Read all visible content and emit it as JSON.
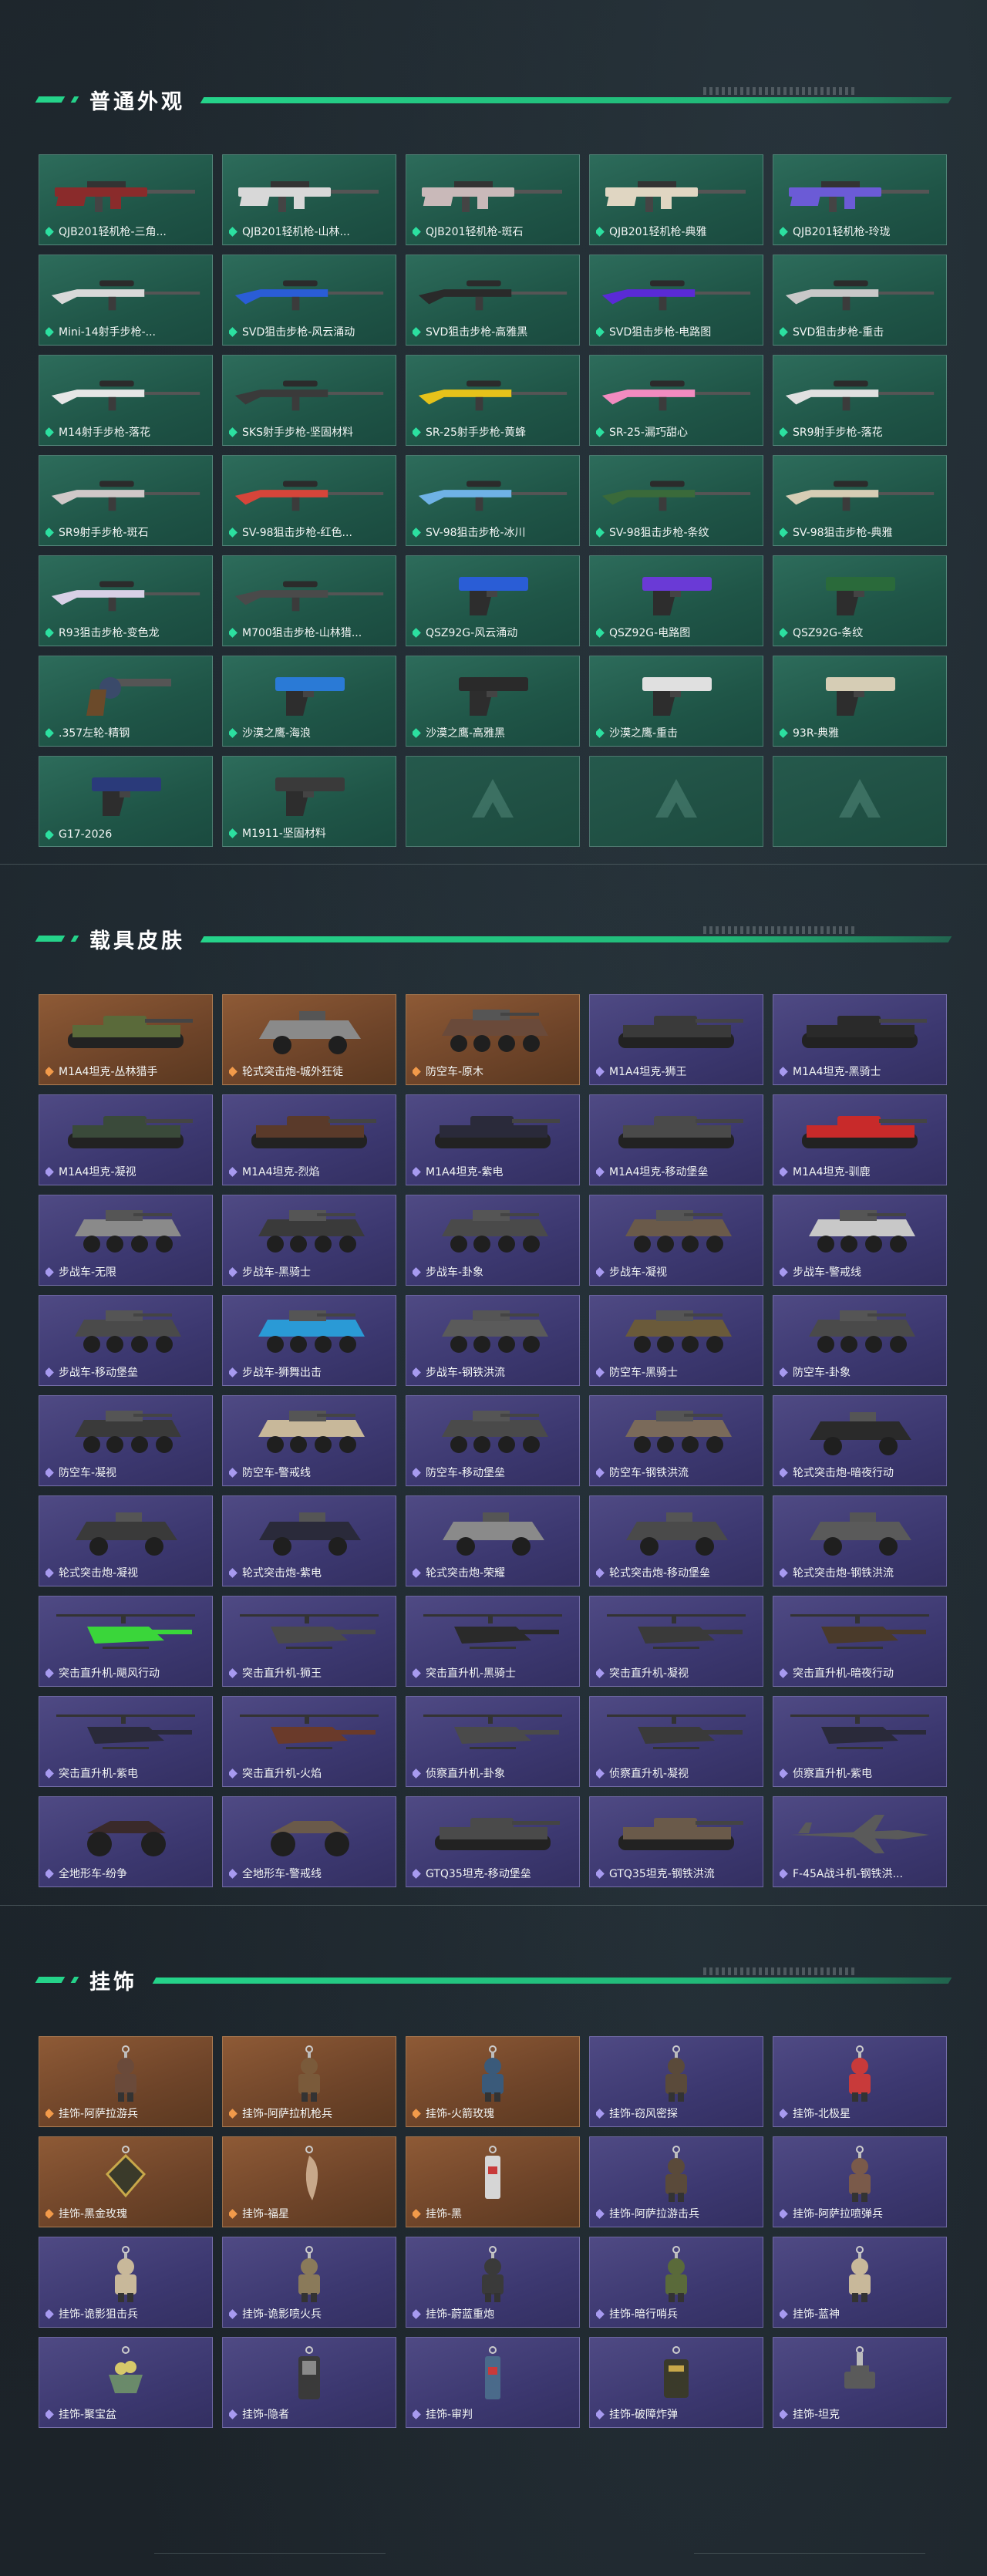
{
  "sections": [
    {
      "title": "普通外观",
      "theme": "green",
      "items": [
        {
          "label": "QJB201轻机枪-三角...",
          "icon": "rifle-icon",
          "accent": "#8a2b2b"
        },
        {
          "label": "QJB201轻机枪-山林...",
          "icon": "rifle-icon",
          "accent": "#d8d8d8"
        },
        {
          "label": "QJB201轻机枪-斑石",
          "icon": "rifle-icon",
          "accent": "#c9b9b9"
        },
        {
          "label": "QJB201轻机枪-典雅",
          "icon": "rifle-icon",
          "accent": "#e0d6c2"
        },
        {
          "label": "QJB201轻机枪-玲珑",
          "icon": "rifle-icon",
          "accent": "#6b5bd6"
        },
        {
          "label": "Mini-14射手步枪-...",
          "icon": "sniper-rifle-icon",
          "accent": "#d9d9d9"
        },
        {
          "label": "SVD狙击步枪-风云涌动",
          "icon": "sniper-rifle-icon",
          "accent": "#2a5dd6"
        },
        {
          "label": "SVD狙击步枪-高雅黑",
          "icon": "sniper-rifle-icon",
          "accent": "#2a2a2a"
        },
        {
          "label": "SVD狙击步枪-电路图",
          "icon": "sniper-rifle-icon",
          "accent": "#5a2ad6"
        },
        {
          "label": "SVD狙击步枪-重击",
          "icon": "sniper-rifle-icon",
          "accent": "#c8c8c8"
        },
        {
          "label": "M14射手步枪-落花",
          "icon": "sniper-rifle-icon",
          "accent": "#e6e6e6"
        },
        {
          "label": "SKS射手步枪-坚固材料",
          "icon": "sniper-rifle-icon",
          "accent": "#3a3a3a"
        },
        {
          "label": "SR-25射手步枪-黄蜂",
          "icon": "sniper-rifle-icon",
          "accent": "#e6c21a"
        },
        {
          "label": "SR-25-漏巧甜心",
          "icon": "sniper-rifle-icon",
          "accent": "#f28bc0"
        },
        {
          "label": "SR9射手步枪-落花",
          "icon": "sniper-rifle-icon",
          "accent": "#e0e0e0"
        },
        {
          "label": "SR9射手步枪-斑石",
          "icon": "sniper-rifle-icon",
          "accent": "#d0c8c8"
        },
        {
          "label": "SV-98狙击步枪-红色...",
          "icon": "sniper-rifle-icon",
          "accent": "#d6453a"
        },
        {
          "label": "SV-98狙击步枪-冰川",
          "icon": "sniper-rifle-icon",
          "accent": "#6fb2e6"
        },
        {
          "label": "SV-98狙击步枪-条纹",
          "icon": "sniper-rifle-icon",
          "accent": "#3a6a3a"
        },
        {
          "label": "SV-98狙击步枪-典雅",
          "icon": "sniper-rifle-icon",
          "accent": "#d6cdb5"
        },
        {
          "label": "R93狙击步枪-变色龙",
          "icon": "sniper-rifle-icon",
          "accent": "#d8d0e6"
        },
        {
          "label": "M700狙击步枪-山林猎...",
          "icon": "sniper-rifle-icon",
          "accent": "#4a4a4a"
        },
        {
          "label": "QSZ92G-风云涌动",
          "icon": "pistol-icon",
          "accent": "#2a5dd6"
        },
        {
          "label": "QSZ92G-电路图",
          "icon": "pistol-icon",
          "accent": "#6a3ad6"
        },
        {
          "label": "QSZ92G-条纹",
          "icon": "pistol-icon",
          "accent": "#2a6a3a"
        },
        {
          "label": ".357左轮-精钢",
          "icon": "revolver-icon",
          "accent": "#3a4a6a"
        },
        {
          "label": "沙漠之鹰-海浪",
          "icon": "pistol-icon",
          "accent": "#2a7ad6"
        },
        {
          "label": "沙漠之鹰-高雅黑",
          "icon": "pistol-icon",
          "accent": "#2a2a2a"
        },
        {
          "label": "沙漠之鹰-重击",
          "icon": "pistol-icon",
          "accent": "#e0e0e0"
        },
        {
          "label": "93R-典雅",
          "icon": "pistol-icon",
          "accent": "#d6cdb5"
        },
        {
          "label": "G17-2026",
          "icon": "pistol-icon",
          "accent": "#2a3a7a"
        },
        {
          "label": "M1911-坚固材料",
          "icon": "pistol-icon",
          "accent": "#3a3a3a"
        },
        {
          "label": "",
          "icon": "placeholder-logo-icon",
          "empty": true
        },
        {
          "label": "",
          "icon": "placeholder-logo-icon",
          "empty": true
        },
        {
          "label": "",
          "icon": "placeholder-logo-icon",
          "empty": true
        }
      ]
    },
    {
      "title": "载具皮肤",
      "items": [
        {
          "label": "M1A4坦克-丛林猎手",
          "icon": "tank-icon",
          "theme": "orange",
          "accent": "#5a6a3a"
        },
        {
          "label": "轮式突击炮-城外狂徒",
          "icon": "armored-car-icon",
          "theme": "orange",
          "accent": "#8a8a8a"
        },
        {
          "label": "防空车-原木",
          "icon": "apc-icon",
          "theme": "orange",
          "accent": "#6a4a3a"
        },
        {
          "label": "M1A4坦克-狮王",
          "icon": "tank-icon",
          "theme": "purple",
          "accent": "#3a3a3a"
        },
        {
          "label": "M1A4坦克-黑骑士",
          "icon": "tank-icon",
          "theme": "purple",
          "accent": "#2a2a2a"
        },
        {
          "label": "M1A4坦克-凝视",
          "icon": "tank-icon",
          "theme": "purple",
          "accent": "#3a4a3a"
        },
        {
          "label": "M1A4坦克-烈焰",
          "icon": "tank-icon",
          "theme": "purple",
          "accent": "#5a3a2a"
        },
        {
          "label": "M1A4坦克-紫电",
          "icon": "tank-icon",
          "theme": "purple",
          "accent": "#2a2a3a"
        },
        {
          "label": "M1A4坦克-移动堡垒",
          "icon": "tank-icon",
          "theme": "purple",
          "accent": "#4a4a4a"
        },
        {
          "label": "M1A4坦克-驯鹿",
          "icon": "tank-icon",
          "theme": "purple",
          "accent": "#c82a2a"
        },
        {
          "label": "步战车-无限",
          "icon": "apc-icon",
          "theme": "purple",
          "accent": "#8a8a8a"
        },
        {
          "label": "步战车-黑骑士",
          "icon": "apc-icon",
          "theme": "purple",
          "accent": "#3a3a3a"
        },
        {
          "label": "步战车-卦象",
          "icon": "apc-icon",
          "theme": "purple",
          "accent": "#4a4a4a"
        },
        {
          "label": "步战车-凝视",
          "icon": "apc-icon",
          "theme": "purple",
          "accent": "#6a5a4a"
        },
        {
          "label": "步战车-警戒线",
          "icon": "apc-icon",
          "theme": "purple",
          "accent": "#c8c8c8"
        },
        {
          "label": "步战车-移动堡垒",
          "icon": "apc-icon",
          "theme": "purple",
          "accent": "#4a4a4a"
        },
        {
          "label": "步战车-狮舞出击",
          "icon": "apc-icon",
          "theme": "purple",
          "accent": "#2a9ad6"
        },
        {
          "label": "步战车-钢铁洪流",
          "icon": "apc-icon",
          "theme": "purple",
          "accent": "#5a5a5a"
        },
        {
          "label": "防空车-黑骑士",
          "icon": "apc-icon",
          "theme": "purple",
          "accent": "#6a5a3a"
        },
        {
          "label": "防空车-卦象",
          "icon": "apc-icon",
          "theme": "purple",
          "accent": "#4a4a4a"
        },
        {
          "label": "防空车-凝视",
          "icon": "apc-icon",
          "theme": "purple",
          "accent": "#3a3a3a"
        },
        {
          "label": "防空车-警戒线",
          "icon": "apc-icon",
          "theme": "purple",
          "accent": "#c8b89a"
        },
        {
          "label": "防空车-移动堡垒",
          "icon": "apc-icon",
          "theme": "purple",
          "accent": "#4a4a4a"
        },
        {
          "label": "防空车-钢铁洪流",
          "icon": "apc-icon",
          "theme": "purple",
          "accent": "#7a6a5a"
        },
        {
          "label": "轮式突击炮-暗夜行动",
          "icon": "armored-car-icon",
          "theme": "purple",
          "accent": "#2a2a2a"
        },
        {
          "label": "轮式突击炮-凝视",
          "icon": "armored-car-icon",
          "theme": "purple",
          "accent": "#3a3a3a"
        },
        {
          "label": "轮式突击炮-紫电",
          "icon": "armored-car-icon",
          "theme": "purple",
          "accent": "#2a2a3a"
        },
        {
          "label": "轮式突击炮-荣耀",
          "icon": "armored-car-icon",
          "theme": "purple",
          "accent": "#8a8a8a"
        },
        {
          "label": "轮式突击炮-移动堡垒",
          "icon": "armored-car-icon",
          "theme": "purple",
          "accent": "#4a4a4a"
        },
        {
          "label": "轮式突击炮-钢铁洪流",
          "icon": "armored-car-icon",
          "theme": "purple",
          "accent": "#5a5a5a"
        },
        {
          "label": "突击直升机-飓风行动",
          "icon": "helicopter-icon",
          "theme": "purple",
          "accent": "#3ad63a"
        },
        {
          "label": "突击直升机-狮王",
          "icon": "helicopter-icon",
          "theme": "purple",
          "accent": "#4a4a4a"
        },
        {
          "label": "突击直升机-黑骑士",
          "icon": "helicopter-icon",
          "theme": "purple",
          "accent": "#2a2a2a"
        },
        {
          "label": "突击直升机-凝视",
          "icon": "helicopter-icon",
          "theme": "purple",
          "accent": "#3a3a3a"
        },
        {
          "label": "突击直升机-暗夜行动",
          "icon": "helicopter-icon",
          "theme": "purple",
          "accent": "#4a3a2a"
        },
        {
          "label": "突击直升机-紫电",
          "icon": "helicopter-icon",
          "theme": "purple",
          "accent": "#2a2a3a"
        },
        {
          "label": "突击直升机-火焰",
          "icon": "helicopter-icon",
          "theme": "purple",
          "accent": "#6a3a2a"
        },
        {
          "label": "侦察直升机-卦象",
          "icon": "helicopter-icon",
          "theme": "purple",
          "accent": "#4a4a4a"
        },
        {
          "label": "侦察直升机-凝视",
          "icon": "helicopter-icon",
          "theme": "purple",
          "accent": "#3a3a3a"
        },
        {
          "label": "侦察直升机-紫电",
          "icon": "helicopter-icon",
          "theme": "purple",
          "accent": "#2a2a3a"
        },
        {
          "label": "全地形车-纷争",
          "icon": "atv-icon",
          "theme": "purple",
          "accent": "#3a2a2a"
        },
        {
          "label": "全地形车-警戒线",
          "icon": "atv-icon",
          "theme": "purple",
          "accent": "#6a5a4a"
        },
        {
          "label": "GTQ35坦克-移动堡垒",
          "icon": "tank-icon",
          "theme": "purple",
          "accent": "#4a4a4a"
        },
        {
          "label": "GTQ35坦克-钢铁洪流",
          "icon": "tank-icon",
          "theme": "purple",
          "accent": "#6a5a4a"
        },
        {
          "label": "F-45A战斗机-钢铁洪...",
          "icon": "jet-icon",
          "theme": "purple",
          "accent": "#5a5a5a"
        }
      ]
    },
    {
      "title": "挂饰",
      "items": [
        {
          "label": "挂饰-阿萨拉游兵",
          "icon": "charm-figure-icon",
          "theme": "orange",
          "accent": "#6a4a3a"
        },
        {
          "label": "挂饰-阿萨拉机枪兵",
          "icon": "charm-figure-icon",
          "theme": "orange",
          "accent": "#7a5a3a"
        },
        {
          "label": "挂饰-火箭玫瑰",
          "icon": "charm-figure-icon",
          "theme": "orange",
          "accent": "#3a5a7a"
        },
        {
          "label": "挂饰-窃风密探",
          "icon": "charm-figure-icon",
          "theme": "purple",
          "accent": "#5a4a3a"
        },
        {
          "label": "挂饰-北极星",
          "icon": "charm-figure-icon",
          "theme": "purple",
          "accent": "#c83a3a"
        },
        {
          "label": "挂饰-黑金玫瑰",
          "icon": "charm-badge-icon",
          "theme": "orange",
          "accent": "#3a3a2a"
        },
        {
          "label": "挂饰-福星",
          "icon": "charm-bird-icon",
          "theme": "orange",
          "accent": "#c8a88a"
        },
        {
          "label": "挂饰-黑",
          "icon": "charm-tag-icon",
          "theme": "orange",
          "accent": "#d6d6d6"
        },
        {
          "label": "挂饰-阿萨拉游击兵",
          "icon": "charm-figure-icon",
          "theme": "purple",
          "accent": "#5a4a3a"
        },
        {
          "label": "挂饰-阿萨拉喷弹兵",
          "icon": "charm-figure-icon",
          "theme": "purple",
          "accent": "#7a5a4a"
        },
        {
          "label": "挂饰-诡影狙击兵",
          "icon": "charm-figure-icon",
          "theme": "purple",
          "accent": "#c8b89a"
        },
        {
          "label": "挂饰-诡影喷火兵",
          "icon": "charm-figure-icon",
          "theme": "purple",
          "accent": "#8a7a5a"
        },
        {
          "label": "挂饰-蔚蓝重炮",
          "icon": "charm-figure-icon",
          "theme": "purple",
          "accent": "#3a3a3a"
        },
        {
          "label": "挂饰-暗行哨兵",
          "icon": "charm-figure-icon",
          "theme": "purple",
          "accent": "#5a6a3a"
        },
        {
          "label": "挂饰-蓝神",
          "icon": "charm-figure-icon",
          "theme": "purple",
          "accent": "#c8b89a"
        },
        {
          "label": "挂饰-聚宝盆",
          "icon": "charm-bowl-icon",
          "theme": "purple",
          "accent": "#6a8a6a"
        },
        {
          "label": "挂饰-隐者",
          "icon": "charm-phone-icon",
          "theme": "purple",
          "accent": "#3a3a3a"
        },
        {
          "label": "挂饰-审判",
          "icon": "charm-tag-icon",
          "theme": "purple",
          "accent": "#4a6a8a"
        },
        {
          "label": "挂饰-破障炸弹",
          "icon": "charm-bomb-icon",
          "theme": "purple",
          "accent": "#3a3a2a"
        },
        {
          "label": "挂饰-坦克",
          "icon": "charm-tank-icon",
          "theme": "purple",
          "accent": "#5a5a5a"
        }
      ]
    }
  ],
  "colors": {
    "accent_green": "#25d38a",
    "card_green": "#2d6c5b",
    "card_orange": "#8e5a36",
    "card_purple": "#4f4a84",
    "background": "#1b2228"
  }
}
